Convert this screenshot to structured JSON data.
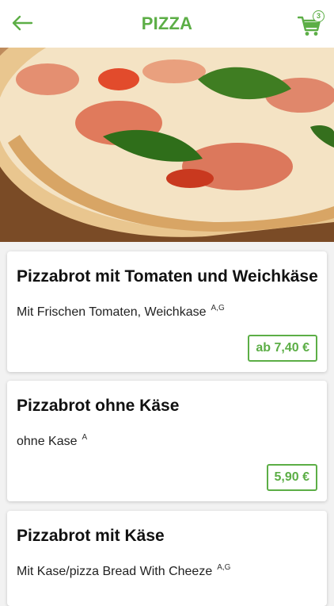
{
  "header": {
    "title": "PIZZA",
    "cart_count": "3",
    "accent_color": "#5cae46"
  },
  "icons": [
    "arrow-left-icon",
    "cart-icon"
  ],
  "products": [
    {
      "name": "Pizzabrot mit Tomaten und Weichkäse",
      "description": "Mit Frischen Tomaten, Weichkase",
      "allergens": "A,G",
      "price": "ab 7,40 €"
    },
    {
      "name": "Pizzabrot ohne Käse",
      "description": "ohne Kase",
      "allergens": "A",
      "price": "5,90 €"
    },
    {
      "name": "Pizzabrot mit Käse",
      "description": "Mit Kase/pizza Bread With Cheeze",
      "allergens": "A,G",
      "price": ""
    }
  ]
}
